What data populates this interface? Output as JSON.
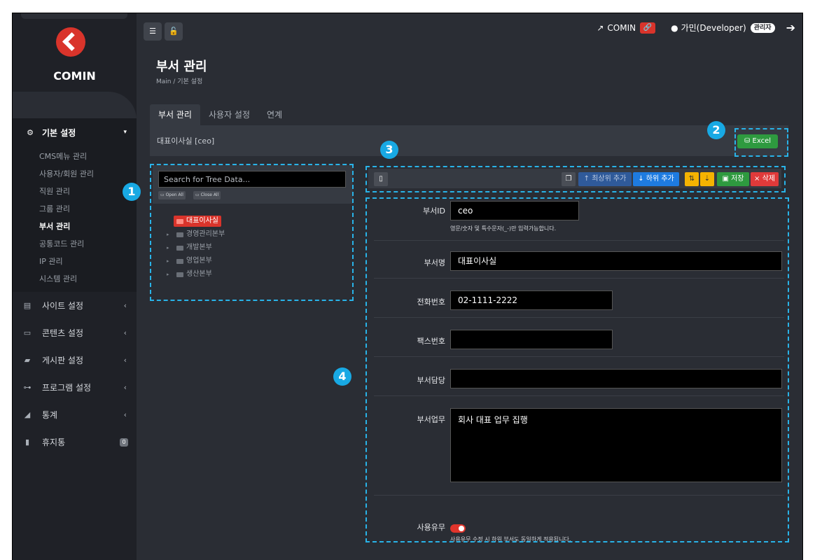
{
  "brand": {
    "logo_text": "COMIN"
  },
  "header": {
    "site_link": "COMIN",
    "user": "가민(Developer)",
    "role_badge": "관리자"
  },
  "sidebar": {
    "section": {
      "label": "기본 설정",
      "items": [
        "CMS메뉴 관리",
        "사용자/회원 관리",
        "직원 관리",
        "그룹 관리",
        "부서 관리",
        "공통코드 관리",
        "IP 관리",
        "시스템 관리"
      ],
      "active_index": 4
    },
    "menu": [
      {
        "label": "사이트 설정",
        "icon": "server-icon"
      },
      {
        "label": "콘텐츠 설정",
        "icon": "content-icon"
      },
      {
        "label": "게시판 설정",
        "icon": "board-icon"
      },
      {
        "label": "프로그램 설정",
        "icon": "program-icon"
      },
      {
        "label": "통계",
        "icon": "chart-icon"
      },
      {
        "label": "휴지통",
        "icon": "trash-icon",
        "badge": "0"
      }
    ]
  },
  "page": {
    "title": "부서 관리",
    "breadcrumb": "Main  /  기본 설정"
  },
  "tabs": [
    "부서 관리",
    "사용자 설정",
    "연계"
  ],
  "selected_dept": "대표이사실 [ceo]",
  "excel_label": "Excel",
  "tree": {
    "search_placeholder": "Search for Tree Data...",
    "open_all": "Open All",
    "close_all": "Close All",
    "nodes": [
      "대표이사실",
      "경영관리본부",
      "개발본부",
      "영업본부",
      "생산본부"
    ]
  },
  "toolbar": {
    "add_top": "최상위 추가",
    "add_child": "하위 추가",
    "save": "저장",
    "delete": "삭제"
  },
  "form": {
    "dept_id_label": "부서ID",
    "dept_id_value": "ceo",
    "dept_id_help": "영문/숫자 및 특수문자(_-)만 입력가능합니다.",
    "dept_name_label": "부서명",
    "dept_name_value": "대표이사실",
    "phone_label": "전화번호",
    "phone_value": "02-1111-2222",
    "fax_label": "팩스번호",
    "fax_value": "",
    "manager_label": "부서담당",
    "manager_value": "",
    "duty_label": "부서업무",
    "duty_value": "회사 대표 업무 집행",
    "use_label": "사용유무",
    "use_help": "사용유무 수정 시 하위 부서도 동일하게 적용됩니다."
  },
  "callouts": [
    "1",
    "2",
    "3",
    "4"
  ],
  "colors": {
    "accent_red": "#d9342b",
    "callout_blue": "#29b3e8",
    "excel_green": "#2e9a3f"
  }
}
